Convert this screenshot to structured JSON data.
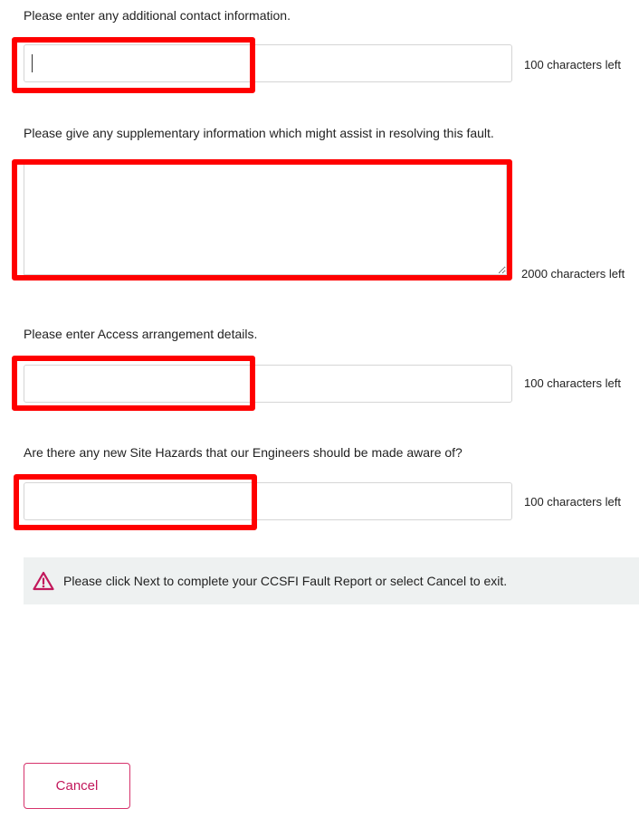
{
  "contact": {
    "label": "Please enter any additional contact information.",
    "value": "",
    "counter": "100 characters left"
  },
  "supplementary": {
    "label": "Please give any supplementary information which might assist in resolving this fault.",
    "value": "",
    "counter": "2000 characters left"
  },
  "access": {
    "label": "Please enter Access arrangement details.",
    "value": "",
    "counter": "100 characters left"
  },
  "hazards": {
    "label": "Are there any new Site Hazards that our Engineers should be made aware of?",
    "value": "",
    "counter": "100 characters left"
  },
  "notice": {
    "icon": "warning-triangle-icon",
    "text": "Please click Next to complete your CCSFI Fault Report or select Cancel to exit."
  },
  "actions": {
    "cancel_label": "Cancel"
  },
  "colors": {
    "highlight": "#ff0000",
    "accent": "#c2185b",
    "notice_bg": "#eef1f1"
  }
}
